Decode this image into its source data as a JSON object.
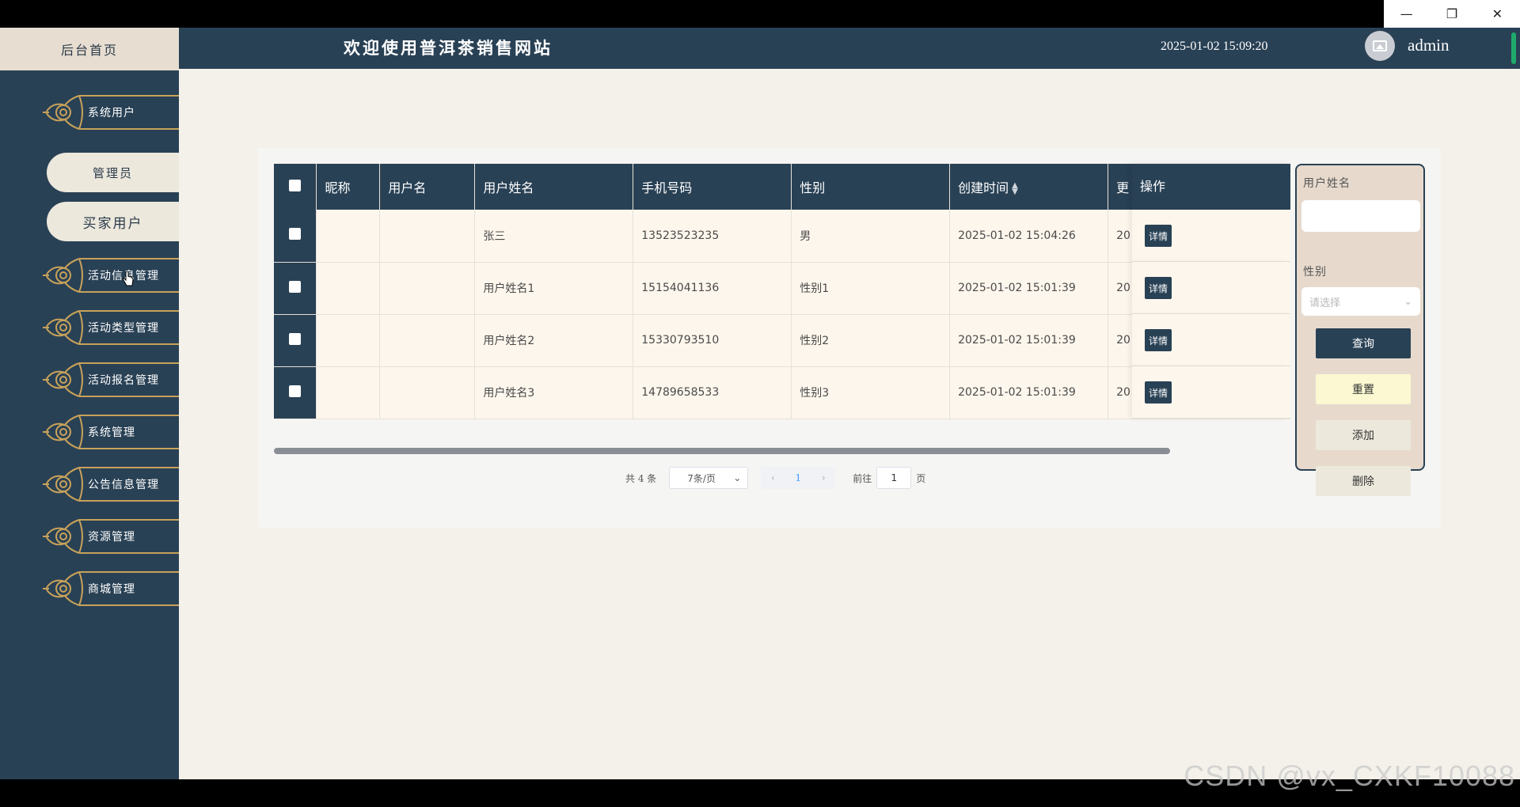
{
  "window": {
    "minimize": "—",
    "restore": "❐",
    "close": "✕"
  },
  "header": {
    "home": "后台首页",
    "title": "欢迎使用普洱茶销售网站",
    "datetime": "2025-01-02 15:09:20",
    "user": "admin"
  },
  "sidebar": {
    "items": [
      {
        "label": "系统用户"
      },
      {
        "label": "活动信息管理"
      },
      {
        "label": "活动类型管理"
      },
      {
        "label": "活动报名管理"
      },
      {
        "label": "系统管理"
      },
      {
        "label": "公告信息管理"
      },
      {
        "label": "资源管理"
      },
      {
        "label": "商城管理"
      }
    ],
    "sub_items": [
      {
        "label": "管理员"
      },
      {
        "label": "买家用户"
      }
    ]
  },
  "table": {
    "headers": [
      "昵称",
      "用户名",
      "用户姓名",
      "手机号码",
      "性别",
      "创建时间",
      "更"
    ],
    "op_header": "操作",
    "detail_label": "详情",
    "rows": [
      {
        "nickname": "",
        "username": "",
        "realname": "张三",
        "phone": "13523523235",
        "gender": "男",
        "created": "2025-01-02 15:04:26",
        "updated": "20"
      },
      {
        "nickname": "",
        "username": "",
        "realname": "用户姓名1",
        "phone": "15154041136",
        "gender": "性别1",
        "created": "2025-01-02 15:01:39",
        "updated": "20"
      },
      {
        "nickname": "",
        "username": "",
        "realname": "用户姓名2",
        "phone": "15330793510",
        "gender": "性别2",
        "created": "2025-01-02 15:01:39",
        "updated": "20"
      },
      {
        "nickname": "",
        "username": "",
        "realname": "用户姓名3",
        "phone": "14789658533",
        "gender": "性别3",
        "created": "2025-01-02 15:01:39",
        "updated": "20"
      }
    ]
  },
  "pagination": {
    "total": "共 4 条",
    "page_size": "7条/页",
    "current": "1",
    "goto": "前往",
    "goto_value": "1",
    "unit": "页"
  },
  "search": {
    "name_label": "用户姓名",
    "name_value": "",
    "gender_label": "性别",
    "gender_placeholder": "请选择",
    "query": "查询",
    "reset": "重置",
    "add": "添加",
    "delete": "删除"
  },
  "watermark": "CSDN @vx_CXKF10088",
  "colors": {
    "primary": "#294155",
    "sidebar_bg": "#294155",
    "row_bg": "#fdf6ec",
    "reset_btn": "#fbf8d2",
    "neutral_btn": "#ece8dc",
    "page_bg": "#f4f1ea"
  }
}
